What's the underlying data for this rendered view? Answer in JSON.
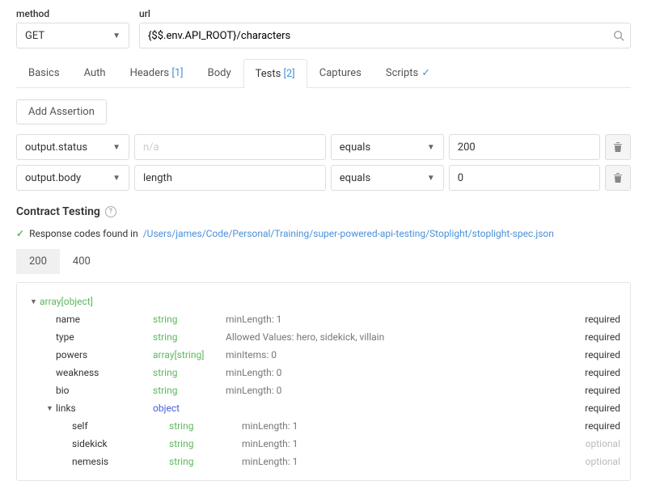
{
  "method": {
    "label": "method",
    "value": "GET"
  },
  "url": {
    "label": "url",
    "value": "{$$.env.API_ROOT}/characters"
  },
  "tabs": [
    {
      "label": "Basics"
    },
    {
      "label": "Auth"
    },
    {
      "label": "Headers",
      "badge": "[1]"
    },
    {
      "label": "Body"
    },
    {
      "label": "Tests",
      "badge": "[2]",
      "active": true
    },
    {
      "label": "Captures"
    },
    {
      "label": "Scripts",
      "check": true
    }
  ],
  "addAssertion": "Add Assertion",
  "assertions": [
    {
      "target": "output.status",
      "prop": "",
      "prop_placeholder": "n/a",
      "op": "equals",
      "val": "200"
    },
    {
      "target": "output.body",
      "prop": "length",
      "op": "equals",
      "val": "0"
    }
  ],
  "contract": {
    "title": "Contract Testing",
    "statusPrefix": "Response codes found in",
    "path": "/Users/james/Code/Personal/Training/super-powered-api-testing/Stoplight/stoplight-spec.json",
    "codes": [
      "200",
      "400"
    ],
    "rootType": "array[object]",
    "props": [
      {
        "name": "name",
        "type": "string",
        "constraint": "minLength: 1",
        "req": true,
        "indent": 1
      },
      {
        "name": "type",
        "type": "string",
        "constraint": "Allowed Values: hero, sidekick, villain",
        "req": true,
        "indent": 1
      },
      {
        "name": "powers",
        "type": "array[string]",
        "constraint": "minItems: 0",
        "req": true,
        "indent": 1
      },
      {
        "name": "weakness",
        "type": "string",
        "constraint": "minLength: 0",
        "req": true,
        "indent": 1
      },
      {
        "name": "bio",
        "type": "string",
        "constraint": "minLength: 0",
        "req": true,
        "indent": 1
      },
      {
        "name": "links",
        "type": "object",
        "constraint": "",
        "req": true,
        "indent": 1,
        "caret": true
      },
      {
        "name": "self",
        "type": "string",
        "constraint": "minLength: 1",
        "req": true,
        "indent": 2
      },
      {
        "name": "sidekick",
        "type": "string",
        "constraint": "minLength: 1",
        "req": false,
        "indent": 2
      },
      {
        "name": "nemesis",
        "type": "string",
        "constraint": "minLength: 1",
        "req": false,
        "indent": 2
      }
    ],
    "requiredLabel": "required",
    "optionalLabel": "optional"
  }
}
